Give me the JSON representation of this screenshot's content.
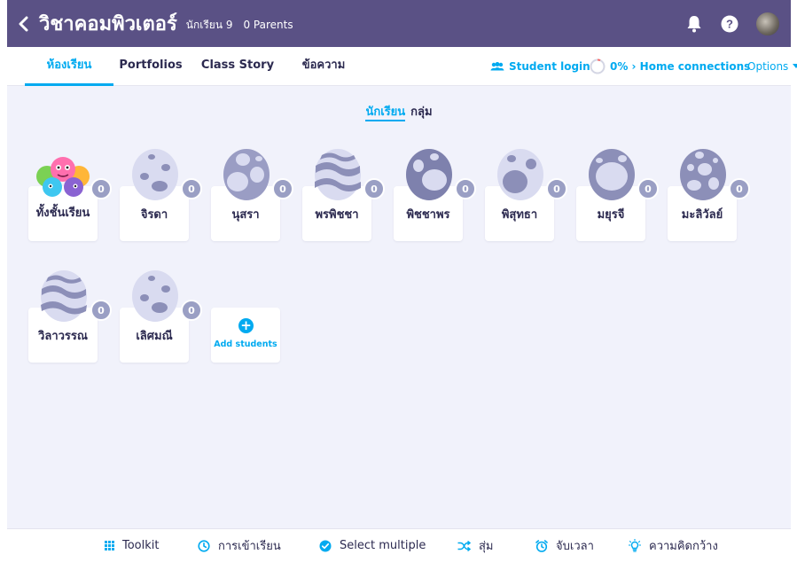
{
  "header": {
    "class_name": "วิชาคอมพิวเตอร์",
    "student_count": "นักเรียน 9",
    "parents": "0 Parents"
  },
  "tabs": [
    {
      "label": "ห้องเรียน",
      "active": true
    },
    {
      "label": "Portfolios"
    },
    {
      "label": "Class Story"
    },
    {
      "label": "ข้อความ"
    }
  ],
  "tabbar_right": {
    "student_login": "Student login",
    "home_connections": "0% › Home connections",
    "options": "Options"
  },
  "view_toggle": {
    "students": "นักเรียน",
    "groups": "กลุ่ม"
  },
  "whole_class": {
    "name": "ทั้งชั้นเรียน",
    "points": "0"
  },
  "students": [
    {
      "name": "จิรดา",
      "points": "0"
    },
    {
      "name": "นุสรา",
      "points": "0"
    },
    {
      "name": "พรพิชชา",
      "points": "0"
    },
    {
      "name": "พิชชาพร",
      "points": "0"
    },
    {
      "name": "พิสุทธา",
      "points": "0"
    },
    {
      "name": "มยุรจี",
      "points": "0"
    },
    {
      "name": "มะลิวัลย์",
      "points": "0"
    },
    {
      "name": "วิลาวรรณ",
      "points": "0"
    },
    {
      "name": "เลิศมณี",
      "points": "0"
    }
  ],
  "add_students": "Add students",
  "toolbar": {
    "toolkit": "Toolkit",
    "attendance": "การเข้าเรียน",
    "select_multiple": "Select multiple",
    "random": "สุ่ม",
    "timer": "จับเวลา",
    "big_ideas": "ความคิดกว้าง"
  },
  "colors": {
    "header_bg": "#5a5185",
    "accent": "#00aaf0",
    "content_bg": "#f1f2fb",
    "points_badge": "#9a9fc4",
    "egg_light": "#d9dbf0",
    "egg_dark": "#8c8fb8"
  },
  "icons": {
    "back": "chevron-left-icon",
    "bell": "bell-icon",
    "help": "help-icon",
    "student_login": "students-icon",
    "home_connections": "progress-ring-icon",
    "toolkit": "grid-dots-icon",
    "attendance": "clock-icon",
    "select_multiple": "check-icon",
    "random": "shuffle-icon",
    "timer": "alarm-clock-icon",
    "big_ideas": "lightbulb-icon"
  }
}
